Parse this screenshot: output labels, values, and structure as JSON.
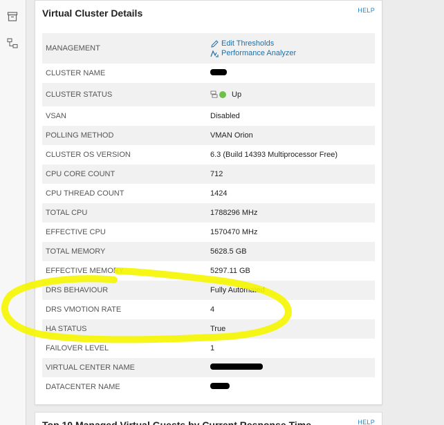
{
  "panel": {
    "title": "Virtual Cluster Details",
    "help": "HELP",
    "management": {
      "label": "MANAGEMENT",
      "edit_thresholds": "Edit Thresholds",
      "performance_analyzer": "Performance Analyzer"
    },
    "rows": [
      {
        "label": "CLUSTER NAME",
        "value": ""
      },
      {
        "label": "CLUSTER STATUS",
        "value": "Up"
      },
      {
        "label": "VSAN",
        "value": "Disabled"
      },
      {
        "label": "POLLING METHOD",
        "value": "VMAN Orion"
      },
      {
        "label": "CLUSTER OS VERSION",
        "value": "6.3 (Build 14393 Multiprocessor Free)"
      },
      {
        "label": "CPU CORE COUNT",
        "value": "712"
      },
      {
        "label": "CPU THREAD COUNT",
        "value": "1424"
      },
      {
        "label": "TOTAL CPU",
        "value": "1788296 MHz"
      },
      {
        "label": "EFFECTIVE CPU",
        "value": "1570470 MHz"
      },
      {
        "label": "TOTAL MEMORY",
        "value": "5628.5 GB"
      },
      {
        "label": "EFFECTIVE MEMORY",
        "value": "5297.11 GB"
      },
      {
        "label": "DRS BEHAVIOUR",
        "value": "Fully Automated"
      },
      {
        "label": "DRS VMOTION RATE",
        "value": "4"
      },
      {
        "label": "HA STATUS",
        "value": "True"
      },
      {
        "label": "FAILOVER LEVEL",
        "value": "1"
      },
      {
        "label": "VIRTUAL CENTER NAME",
        "value": ""
      },
      {
        "label": "DATACENTER NAME",
        "value": ""
      }
    ]
  },
  "panel2": {
    "title": "Top 10 Managed Virtual Guests by Current Response Time",
    "help": "HELP"
  },
  "colors": {
    "accent": "#1e6fa8",
    "status_up": "#6cc04a",
    "highlight": "#f5f500"
  },
  "icons": [
    "archive-icon",
    "network-icon",
    "pencil-icon",
    "performance-analyzer-icon",
    "server-icon",
    "status-up-icon"
  ]
}
